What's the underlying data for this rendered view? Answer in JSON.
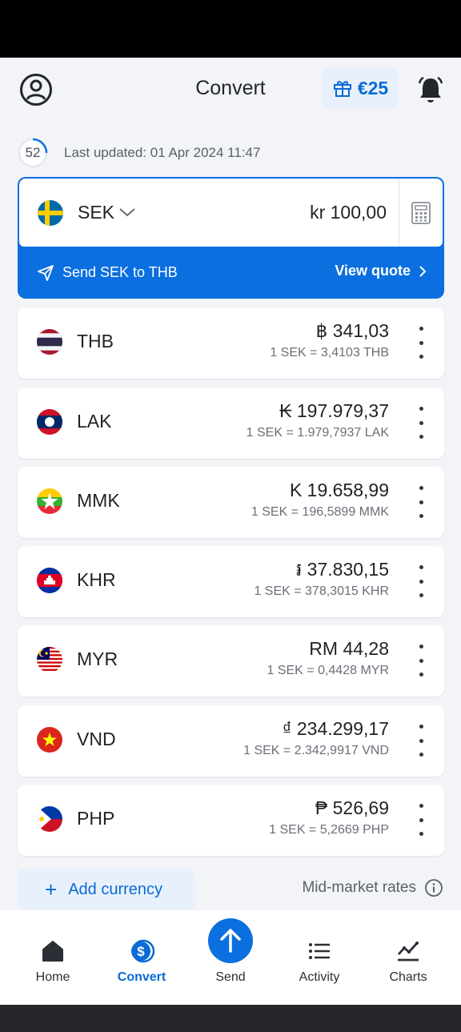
{
  "header": {
    "title": "Convert",
    "promo_label": "€25"
  },
  "updated": {
    "countdown": "52",
    "text": "Last updated: 01 Apr 2024 11:47"
  },
  "base": {
    "code": "SEK",
    "amount": "kr 100,00",
    "send_label": "Send SEK to THB",
    "quote_label": "View quote"
  },
  "currencies": [
    {
      "code": "THB",
      "amount": "฿ 341,03",
      "rate": "1 SEK = 3,4103 THB"
    },
    {
      "code": "LAK",
      "amount": "₭ 197.979,37",
      "rate": "1 SEK = 1.979,7937 LAK"
    },
    {
      "code": "MMK",
      "amount": "K 19.658,99",
      "rate": "1 SEK = 196,5899 MMK"
    },
    {
      "code": "KHR",
      "amount": "៛ 37.830,15",
      "rate": "1 SEK = 378,3015 KHR"
    },
    {
      "code": "MYR",
      "amount": "RM 44,28",
      "rate": "1 SEK = 0,4428 MYR"
    },
    {
      "code": "VND",
      "amount": "₫ 234.299,17",
      "rate": "1 SEK = 2.342,9917 VND"
    },
    {
      "code": "PHP",
      "amount": "₱ 526,69",
      "rate": "1 SEK = 5,2669 PHP"
    }
  ],
  "footer": {
    "add_label": "Add currency",
    "mid_market_label": "Mid-market rates"
  },
  "nav": {
    "home": "Home",
    "convert": "Convert",
    "send": "Send",
    "activity": "Activity",
    "charts": "Charts"
  },
  "colors": {
    "accent": "#0b6fe0",
    "background": "#f2f4f7"
  }
}
